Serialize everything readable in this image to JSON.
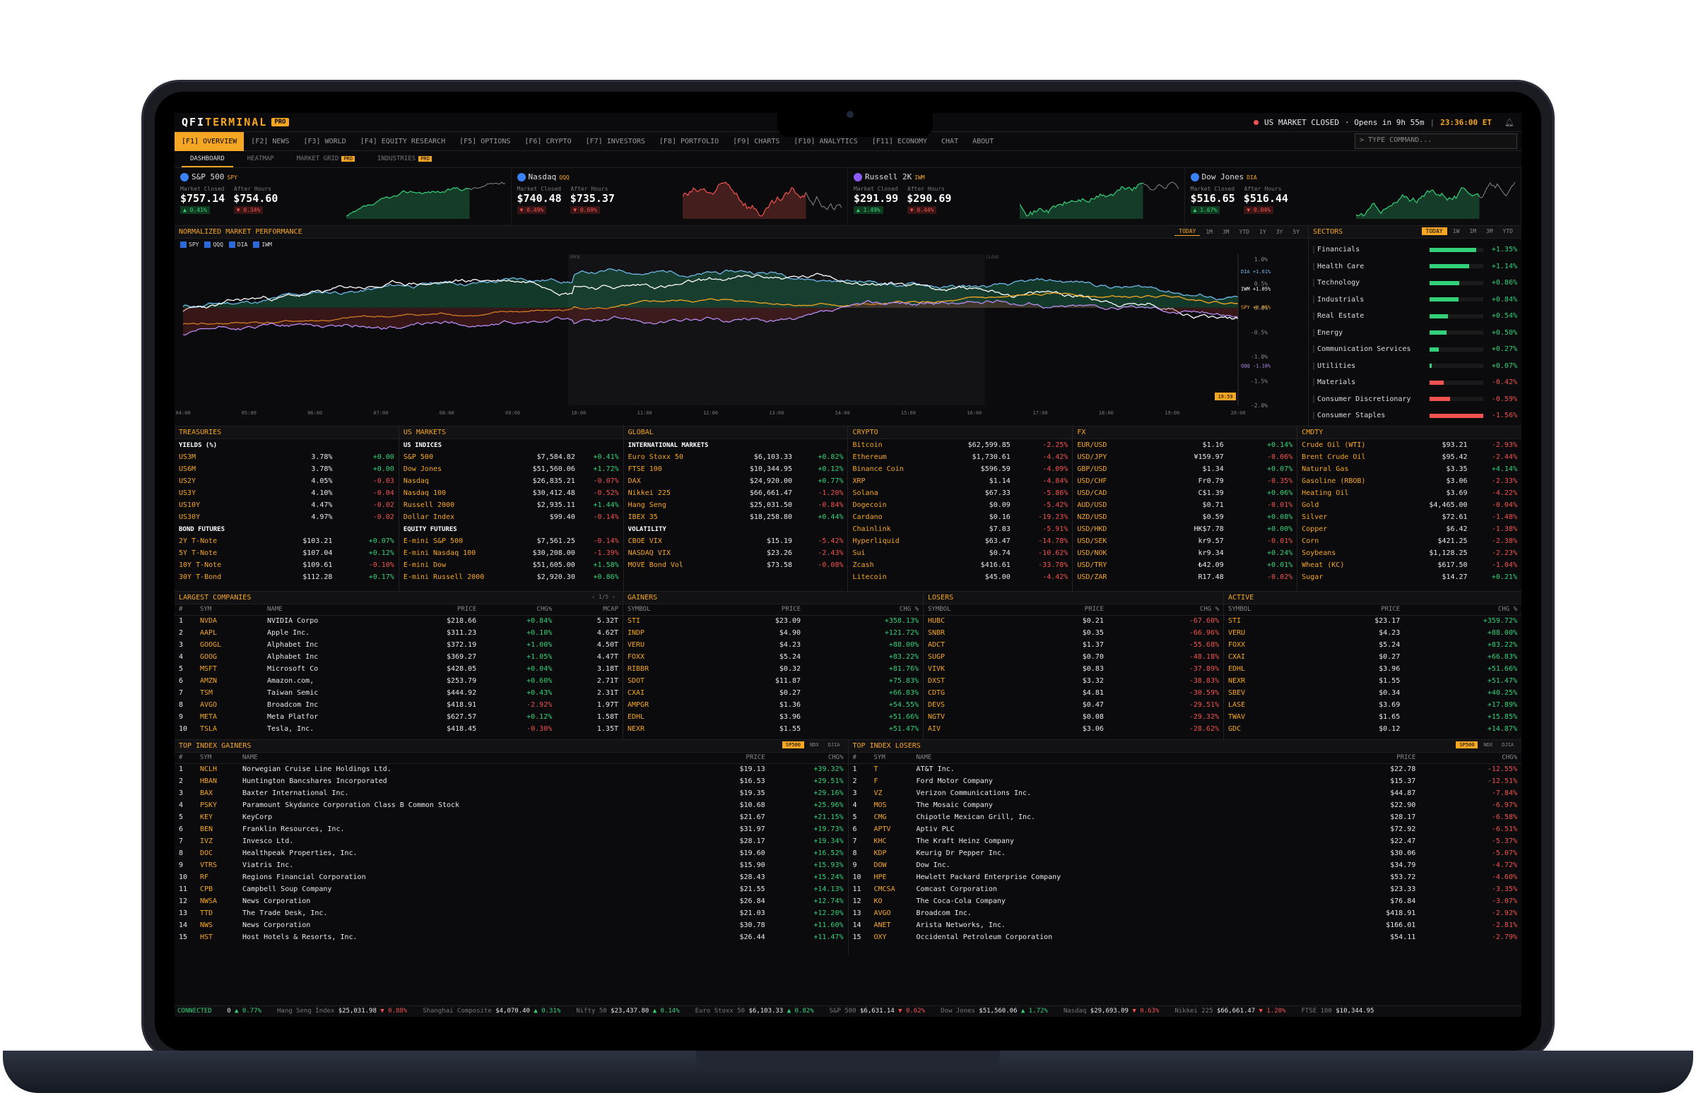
{
  "app": {
    "logo_a": "QFI",
    "logo_b": "TERMINAL",
    "badge": "PRO"
  },
  "status": {
    "market": "US MARKET CLOSED",
    "opens": "· Opens in 9h 55m",
    "clock": "23:36:00 ET"
  },
  "nav": [
    {
      "label": "[F1] OVERVIEW",
      "active": true
    },
    {
      "label": "[F2] NEWS"
    },
    {
      "label": "[F3] WORLD"
    },
    {
      "label": "[F4] EQUITY RESEARCH"
    },
    {
      "label": "[F5] OPTIONS"
    },
    {
      "label": "[F6] CRYPTO"
    },
    {
      "label": "[F7] INVESTORS"
    },
    {
      "label": "[F8] PORTFOLIO"
    },
    {
      "label": "[F9] CHARTS"
    },
    {
      "label": "[F10] ANALYTICS"
    },
    {
      "label": "[F11] ECONOMY"
    },
    {
      "label": "CHAT"
    },
    {
      "label": "ABOUT"
    }
  ],
  "command_placeholder": "> TYPE COMMAND...",
  "subnav": [
    {
      "label": "DASHBOARD",
      "active": true
    },
    {
      "label": "HEATMAP"
    },
    {
      "label": "MARKET GRID",
      "pro": "PRO"
    },
    {
      "label": "INDUSTRIES",
      "pro": "PRO"
    }
  ],
  "tickers": [
    {
      "name": "S&P 500",
      "etf": "SPY",
      "icon_color": "#3b82f6",
      "lbl1": "Market Closed",
      "lbl2": "After Hours",
      "p1": "$757.14",
      "p2": "$754.60",
      "c1": "▲ 0.41%",
      "c2": "▼ 0.34%",
      "c1dir": "up",
      "c2dir": "dn",
      "color": "#33d17a"
    },
    {
      "name": "Nasdaq",
      "etf": "QQQ",
      "icon_color": "#3b82f6",
      "lbl1": "Market Closed",
      "lbl2": "After Hours",
      "p1": "$740.48",
      "p2": "$735.37",
      "c1": "▼ 0.49%",
      "c2": "▼ 0.69%",
      "c1dir": "dn",
      "c2dir": "dn",
      "color": "#f0524f"
    },
    {
      "name": "Russell 2K",
      "etf": "IWM",
      "icon_color": "#8b5cf6",
      "lbl1": "Market Closed",
      "lbl2": "After Hours",
      "p1": "$291.99",
      "p2": "$290.69",
      "c1": "▲ 1.49%",
      "c2": "▼ 0.44%",
      "c1dir": "up",
      "c2dir": "dn",
      "color": "#33d17a"
    },
    {
      "name": "Dow Jones",
      "etf": "DIA",
      "icon_color": "#3b82f6",
      "lbl1": "Market Closed",
      "lbl2": "After Hours",
      "p1": "$516.65",
      "p2": "$516.44",
      "c1": "▲ 1.67%",
      "c2": "▼ 0.04%",
      "c1dir": "up",
      "c2dir": "dn",
      "color": "#33d17a"
    }
  ],
  "perf": {
    "title": "NORMALIZED MARKET PERFORMANCE",
    "ranges": [
      "TODAY",
      "1M",
      "3M",
      "YTD",
      "1Y",
      "3Y",
      "5Y"
    ],
    "legend": [
      "SPY",
      "QQQ",
      "DIA",
      "IWM"
    ],
    "pre": "OPEN",
    "post": "CLOSE",
    "time_label": "19:59",
    "end_labels": [
      {
        "t": "DIA +1.61%",
        "c": "#6fb7e6"
      },
      {
        "t": "IWM +1.05%",
        "c": "#ffffff"
      },
      {
        "t": "SPY +0.05%",
        "c": "#f5a623"
      },
      {
        "t": "QQQ -1.18%",
        "c": "#b58cf0"
      }
    ],
    "yticks": [
      "1.0%",
      "0.5%",
      "0.0%",
      "-0.5%",
      "-1.0%",
      "-1.5%",
      "-2.0%"
    ],
    "xticks": [
      "04:00",
      "05:00",
      "06:00",
      "07:00",
      "08:00",
      "09:00",
      "10:00",
      "11:00",
      "12:00",
      "13:00",
      "14:00",
      "15:00",
      "16:00",
      "17:00",
      "18:00",
      "19:00",
      "20:00"
    ]
  },
  "sectors": {
    "title": "SECTORS",
    "tabs": [
      "TODAY",
      "1W",
      "1M",
      "3M",
      "YTD"
    ],
    "items": [
      {
        "name": "Financials",
        "v": "+1.35%",
        "pct": 1.35
      },
      {
        "name": "Health Care",
        "v": "+1.14%",
        "pct": 1.14
      },
      {
        "name": "Technology",
        "v": "+0.86%",
        "pct": 0.86
      },
      {
        "name": "Industrials",
        "v": "+0.84%",
        "pct": 0.84
      },
      {
        "name": "Real Estate",
        "v": "+0.54%",
        "pct": 0.54
      },
      {
        "name": "Energy",
        "v": "+0.50%",
        "pct": 0.5
      },
      {
        "name": "Communication Services",
        "v": "+0.27%",
        "pct": 0.27
      },
      {
        "name": "Utilities",
        "v": "+0.07%",
        "pct": 0.07
      },
      {
        "name": "Materials",
        "v": "-0.42%",
        "pct": -0.42
      },
      {
        "name": "Consumer Discretionary",
        "v": "-0.59%",
        "pct": -0.59
      },
      {
        "name": "Consumer Staples",
        "v": "-1.56%",
        "pct": -1.56
      }
    ]
  },
  "treasuries": {
    "title": "TREASURIES",
    "h1": "YIELDS (%)",
    "yields": [
      [
        "US3M",
        "3.78%",
        "+0.00"
      ],
      [
        "US6M",
        "3.78%",
        "+0.00"
      ],
      [
        "US2Y",
        "4.05%",
        "-0.03"
      ],
      [
        "US3Y",
        "4.10%",
        "-0.04"
      ],
      [
        "US10Y",
        "4.47%",
        "-0.02"
      ],
      [
        "US30Y",
        "4.97%",
        "-0.02"
      ]
    ],
    "h2": "BOND FUTURES",
    "futures": [
      [
        "2Y T-Note",
        "$103.21",
        "+0.07%"
      ],
      [
        "5Y T-Note",
        "$107.04",
        "+0.12%"
      ],
      [
        "10Y T-Note",
        "$109.61",
        "-0.10%"
      ],
      [
        "30Y T-Bond",
        "$112.28",
        "+0.17%"
      ]
    ]
  },
  "usmarkets": {
    "title": "US MARKETS",
    "h1": "US INDICES",
    "indices": [
      [
        "S&P 500",
        "$7,584.82",
        "+0.41%"
      ],
      [
        "Dow Jones",
        "$51,560.06",
        "+1.72%"
      ],
      [
        "Nasdaq",
        "$26,835.21",
        "-0.07%"
      ],
      [
        "Nasdaq 100",
        "$30,412.48",
        "-0.52%"
      ],
      [
        "Russell 2000",
        "$2,935.11",
        "+1.44%"
      ],
      [
        "Dollar Index",
        "$99.40",
        "-0.14%"
      ]
    ],
    "h2": "EQUITY FUTURES",
    "futures": [
      [
        "E-mini S&P 500",
        "$7,561.25",
        "-0.14%"
      ],
      [
        "E-mini Nasdaq 100",
        "$30,208.00",
        "-1.39%"
      ],
      [
        "E-mini Dow",
        "$51,605.00",
        "+1.58%"
      ],
      [
        "E-mini Russell 2000",
        "$2,920.30",
        "+0.86%"
      ]
    ]
  },
  "global": {
    "title": "GLOBAL",
    "h1": "INTERNATIONAL MARKETS",
    "markets": [
      [
        "Euro Stoxx 50",
        "$6,103.33",
        "+0.82%"
      ],
      [
        "FTSE 100",
        "$10,344.95",
        "+0.12%"
      ],
      [
        "DAX",
        "$24,920.00",
        "+0.77%"
      ],
      [
        "Nikkei 225",
        "$66,661.47",
        "-1.20%"
      ],
      [
        "Hang Seng",
        "$25,031.50",
        "-0.84%"
      ],
      [
        "IBEX 35",
        "$18,258.80",
        "+0.44%"
      ]
    ],
    "h2": "VOLATILITY",
    "vol": [
      [
        "CBOE VIX",
        "$15.19",
        "-5.42%"
      ],
      [
        "NASDAQ VIX",
        "$23.26",
        "-2.43%"
      ],
      [
        "MOVE Bond Vol",
        "$73.58",
        "-0.08%"
      ]
    ]
  },
  "crypto": {
    "title": "CRYPTO",
    "rows": [
      [
        "Bitcoin",
        "$62,599.85",
        "-2.25%"
      ],
      [
        "Ethereum",
        "$1,730.61",
        "-4.42%"
      ],
      [
        "Binance Coin",
        "$596.59",
        "-4.09%"
      ],
      [
        "XRP",
        "$1.14",
        "-4.84%"
      ],
      [
        "Solana",
        "$67.33",
        "-5.86%"
      ],
      [
        "Dogecoin",
        "$0.09",
        "-5.42%"
      ],
      [
        "Cardano",
        "$0.16",
        "-19.23%"
      ],
      [
        "Chainlink",
        "$7.83",
        "-5.91%"
      ],
      [
        "Hyperliquid",
        "$63.47",
        "-14.78%"
      ],
      [
        "Sui",
        "$0.74",
        "-10.62%"
      ],
      [
        "Zcash",
        "$416.61",
        "-33.78%"
      ],
      [
        "Litecoin",
        "$45.00",
        "-4.42%"
      ]
    ]
  },
  "fx": {
    "title": "FX",
    "rows": [
      [
        "EUR/USD",
        "$1.16",
        "+0.14%"
      ],
      [
        "USD/JPY",
        "¥159.97",
        "-0.06%"
      ],
      [
        "GBP/USD",
        "$1.34",
        "+0.07%"
      ],
      [
        "USD/CHF",
        "Fr0.79",
        "-0.35%"
      ],
      [
        "USD/CAD",
        "C$1.39",
        "+0.06%"
      ],
      [
        "AUD/USD",
        "$0.71",
        "-0.01%"
      ],
      [
        "NZD/USD",
        "$0.59",
        "+0.08%"
      ],
      [
        "USD/HKD",
        "HK$7.78",
        "+0.00%"
      ],
      [
        "USD/SEK",
        "kr9.57",
        "-0.01%"
      ],
      [
        "USD/NOK",
        "kr9.34",
        "+0.24%"
      ],
      [
        "USD/TRY",
        "₺42.09",
        "+0.01%"
      ],
      [
        "USD/ZAR",
        "R17.48",
        "-0.02%"
      ]
    ]
  },
  "cmdty": {
    "title": "CMDTY",
    "rows": [
      [
        "Crude Oil (WTI)",
        "$93.21",
        "-2.93%"
      ],
      [
        "Brent Crude Oil",
        "$95.42",
        "-2.44%"
      ],
      [
        "Natural Gas",
        "$3.35",
        "+4.14%"
      ],
      [
        "Gasoline (RBOB)",
        "$3.06",
        "-2.33%"
      ],
      [
        "Heating Oil",
        "$3.69",
        "-4.22%"
      ],
      [
        "Gold",
        "$4,465.00",
        "-0.04%"
      ],
      [
        "Silver",
        "$72.61",
        "-1.48%"
      ],
      [
        "Copper",
        "$6.42",
        "-1.38%"
      ],
      [
        "Corn",
        "$421.25",
        "-2.38%"
      ],
      [
        "Soybeans",
        "$1,128.25",
        "-2.23%"
      ],
      [
        "Wheat (KC)",
        "$617.50",
        "-1.04%"
      ],
      [
        "Sugar",
        "$14.27",
        "+0.21%"
      ]
    ]
  },
  "largest": {
    "title": "LARGEST COMPANIES",
    "pager": "‹ 1/5 ›",
    "cols": [
      "#",
      "SYM",
      "NAME",
      "PRICE",
      "CHG%",
      "MCAP"
    ],
    "rows": [
      [
        "1",
        "NVDA",
        "NVIDIA Corpo",
        "$218.66",
        "+0.84%",
        "5.32T"
      ],
      [
        "2",
        "AAPL",
        "Apple Inc.",
        "$311.23",
        "+0.10%",
        "4.62T"
      ],
      [
        "3",
        "GOOGL",
        "Alphabet Inc",
        "$372.19",
        "+1.00%",
        "4.50T"
      ],
      [
        "4",
        "GOOG",
        "Alphabet Inc",
        "$369.27",
        "+1.05%",
        "4.47T"
      ],
      [
        "5",
        "MSFT",
        "Microsoft Co",
        "$428.05",
        "+0.04%",
        "3.18T"
      ],
      [
        "6",
        "AMZN",
        "Amazon.com,",
        "$253.79",
        "+0.60%",
        "2.71T"
      ],
      [
        "7",
        "TSM",
        "Taiwan Semic",
        "$444.92",
        "+0.43%",
        "2.31T"
      ],
      [
        "8",
        "AVGO",
        "Broadcom Inc",
        "$418.91",
        "-2.92%",
        "1.97T"
      ],
      [
        "9",
        "META",
        "Meta Platfor",
        "$627.57",
        "+0.12%",
        "1.58T"
      ],
      [
        "10",
        "TSLA",
        "Tesla, Inc.",
        "$418.45",
        "-0.30%",
        "1.35T"
      ]
    ]
  },
  "gainers": {
    "title": "GAINERS",
    "cols": [
      "SYMBOL",
      "PRICE",
      "CHG %"
    ],
    "rows": [
      [
        "STI",
        "$23.09",
        "+358.13%"
      ],
      [
        "INDP",
        "$4.90",
        "+121.72%"
      ],
      [
        "VERU",
        "$4.23",
        "+88.00%"
      ],
      [
        "FOXX",
        "$5.24",
        "+83.22%"
      ],
      [
        "RIBBR",
        "$0.32",
        "+81.76%"
      ],
      [
        "SDOT",
        "$11.87",
        "+75.83%"
      ],
      [
        "CXAI",
        "$0.27",
        "+66.83%"
      ],
      [
        "AMPGR",
        "$1.36",
        "+54.55%"
      ],
      [
        "EDHL",
        "$3.96",
        "+51.66%"
      ],
      [
        "NEXR",
        "$1.55",
        "+51.47%"
      ]
    ]
  },
  "losers": {
    "title": "LOSERS",
    "cols": [
      "SYMBOL",
      "PRICE",
      "CHG %"
    ],
    "rows": [
      [
        "HUBC",
        "$0.21",
        "-67.60%"
      ],
      [
        "SNBR",
        "$0.35",
        "-66.96%"
      ],
      [
        "ADCT",
        "$1.37",
        "-55.68%"
      ],
      [
        "SUGP",
        "$0.70",
        "-48.18%"
      ],
      [
        "VIVK",
        "$0.83",
        "-37.89%"
      ],
      [
        "DXST",
        "$3.32",
        "-38.83%"
      ],
      [
        "CDTG",
        "$4.81",
        "-30.59%"
      ],
      [
        "DEVS",
        "$0.47",
        "-29.51%"
      ],
      [
        "NGTV",
        "$0.08",
        "-29.32%"
      ],
      [
        "AIV",
        "$3.06",
        "-28.62%"
      ]
    ]
  },
  "active": {
    "title": "ACTIVE",
    "cols": [
      "SYMBOL",
      "PRICE",
      "CHG %"
    ],
    "rows": [
      [
        "STI",
        "$23.17",
        "+359.72%"
      ],
      [
        "VERU",
        "$4.23",
        "+88.00%"
      ],
      [
        "FOXX",
        "$5.24",
        "+83.22%"
      ],
      [
        "CXAI",
        "$0.27",
        "+66.83%"
      ],
      [
        "EDHL",
        "$3.96",
        "+51.66%"
      ],
      [
        "NEXR",
        "$1.55",
        "+51.47%"
      ],
      [
        "SBEV",
        "$0.34",
        "+40.25%"
      ],
      [
        "LASE",
        "$3.69",
        "+17.89%"
      ],
      [
        "TWAV",
        "$1.65",
        "+15.85%"
      ],
      [
        "GDC",
        "$0.12",
        "+14.87%"
      ]
    ]
  },
  "idx_gainers": {
    "title": "TOP INDEX GAINERS",
    "tabs": [
      "SP500",
      "NDX",
      "DJIA"
    ],
    "cols": [
      "#",
      "SYM",
      "NAME",
      "PRICE",
      "CHG%"
    ],
    "rows": [
      [
        "1",
        "NCLH",
        "Norwegian Cruise Line Holdings Ltd.",
        "$19.13",
        "+39.32%"
      ],
      [
        "2",
        "HBAN",
        "Huntington Bancshares Incorporated",
        "$16.53",
        "+29.51%"
      ],
      [
        "3",
        "BAX",
        "Baxter International Inc.",
        "$19.35",
        "+29.16%"
      ],
      [
        "4",
        "PSKY",
        "Paramount Skydance Corporation Class B Common Stock",
        "$10.68",
        "+25.96%"
      ],
      [
        "5",
        "KEY",
        "KeyCorp",
        "$21.67",
        "+21.15%"
      ],
      [
        "6",
        "BEN",
        "Franklin Resources, Inc.",
        "$31.97",
        "+19.73%"
      ],
      [
        "7",
        "IVZ",
        "Invesco Ltd.",
        "$28.17",
        "+19.34%"
      ],
      [
        "8",
        "DOC",
        "Healthpeak Properties, Inc.",
        "$19.60",
        "+16.52%"
      ],
      [
        "9",
        "VTRS",
        "Viatris Inc.",
        "$15.90",
        "+15.93%"
      ],
      [
        "10",
        "RF",
        "Regions Financial Corporation",
        "$28.43",
        "+15.24%"
      ],
      [
        "11",
        "CPB",
        "Campbell Soup Company",
        "$21.55",
        "+14.13%"
      ],
      [
        "12",
        "NWSA",
        "News Corporation",
        "$26.84",
        "+12.74%"
      ],
      [
        "13",
        "TTD",
        "The Trade Desk, Inc.",
        "$21.03",
        "+12.20%"
      ],
      [
        "14",
        "NWS",
        "News Corporation",
        "$30.78",
        "+11.60%"
      ],
      [
        "15",
        "HST",
        "Host Hotels & Resorts, Inc.",
        "$26.44",
        "+11.47%"
      ]
    ]
  },
  "idx_losers": {
    "title": "TOP INDEX LOSERS",
    "tabs": [
      "SP500",
      "NDX",
      "DJIA"
    ],
    "cols": [
      "#",
      "SYM",
      "NAME",
      "PRICE",
      "CHG%"
    ],
    "rows": [
      [
        "1",
        "T",
        "AT&T Inc.",
        "$22.78",
        "-12.55%"
      ],
      [
        "2",
        "F",
        "Ford Motor Company",
        "$15.37",
        "-12.51%"
      ],
      [
        "3",
        "VZ",
        "Verizon Communications Inc.",
        "$44.87",
        "-7.84%"
      ],
      [
        "4",
        "MOS",
        "The Mosaic Company",
        "$22.90",
        "-6.97%"
      ],
      [
        "5",
        "CMG",
        "Chipotle Mexican Grill, Inc.",
        "$28.17",
        "-6.58%"
      ],
      [
        "6",
        "APTV",
        "Aptiv PLC",
        "$72.92",
        "-6.51%"
      ],
      [
        "7",
        "KHC",
        "The Kraft Heinz Company",
        "$22.47",
        "-5.37%"
      ],
      [
        "8",
        "KDP",
        "Keurig Dr Pepper Inc.",
        "$30.06",
        "-5.07%"
      ],
      [
        "9",
        "DOW",
        "Dow Inc.",
        "$34.79",
        "-4.72%"
      ],
      [
        "10",
        "HPE",
        "Hewlett Packard Enterprise Company",
        "$53.72",
        "-4.60%"
      ],
      [
        "11",
        "CMCSA",
        "Comcast Corporation",
        "$23.33",
        "-3.35%"
      ],
      [
        "12",
        "KO",
        "The Coca-Cola Company",
        "$76.84",
        "-3.07%"
      ],
      [
        "13",
        "AVGO",
        "Broadcom Inc.",
        "$418.91",
        "-2.92%"
      ],
      [
        "14",
        "ANET",
        "Arista Networks, Inc.",
        "$166.01",
        "-2.81%"
      ],
      [
        "15",
        "OXY",
        "Occidental Petroleum Corporation",
        "$54.11",
        "-2.79%"
      ]
    ]
  },
  "footer": {
    "status": "CONNECTED",
    "items": [
      [
        "",
        "0",
        "▲ 0.77%",
        "up"
      ],
      [
        "Hang Seng Index",
        "$25,031.98",
        "▼ 0.88%",
        "dn"
      ],
      [
        "Shanghai Composite",
        "$4,070.40",
        "▲ 0.31%",
        "up"
      ],
      [
        "Nifty 50",
        "$23,437.80",
        "▲ 0.14%",
        "up"
      ],
      [
        "Euro Stoxx 50",
        "$6,103.33",
        "▲ 0.82%",
        "up"
      ],
      [
        "S&P 500",
        "$6,631.14",
        "▼ 0.62%",
        "dn"
      ],
      [
        "Dow Jones",
        "$51,560.06",
        "▲ 1.72%",
        "up"
      ],
      [
        "Nasdaq",
        "$29,693.09",
        "▼ 0.63%",
        "dn"
      ],
      [
        "Nikkei 225",
        "$66,661.47",
        "▼ 1.20%",
        "dn"
      ],
      [
        "FTSE 100",
        "$10,344.95",
        "",
        ""
      ]
    ]
  }
}
